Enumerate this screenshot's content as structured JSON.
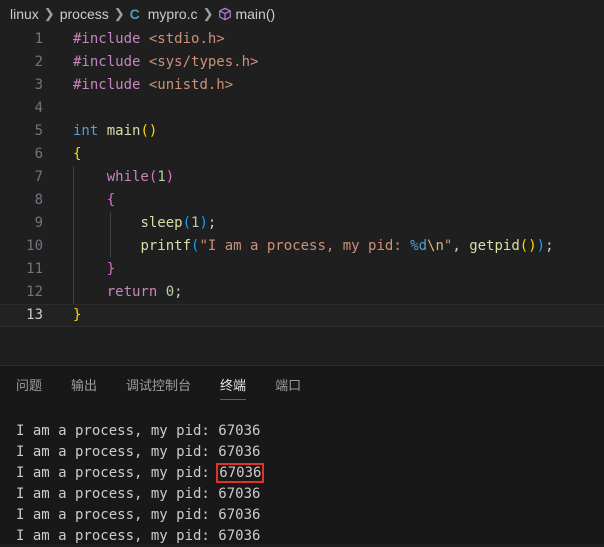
{
  "breadcrumb": {
    "items": [
      "linux",
      "process",
      "mypro.c",
      "main()"
    ],
    "file_icon": "C",
    "icons": [
      "c-file-icon",
      "cube-icon"
    ]
  },
  "editor": {
    "current_line": 13,
    "lines": [
      {
        "num": "1",
        "parts": [
          [
            "kw-inc",
            "#include"
          ],
          [
            "plain",
            " "
          ],
          [
            "str",
            "<stdio.h>"
          ]
        ]
      },
      {
        "num": "2",
        "parts": [
          [
            "kw-inc",
            "#include"
          ],
          [
            "plain",
            " "
          ],
          [
            "str",
            "<sys/types.h>"
          ]
        ]
      },
      {
        "num": "3",
        "parts": [
          [
            "kw-inc",
            "#include"
          ],
          [
            "plain",
            " "
          ],
          [
            "str",
            "<unistd.h>"
          ]
        ]
      },
      {
        "num": "4",
        "parts": []
      },
      {
        "num": "5",
        "parts": [
          [
            "kw-type",
            "int"
          ],
          [
            "plain",
            " "
          ],
          [
            "fn",
            "main"
          ],
          [
            "brace-y",
            "()"
          ]
        ]
      },
      {
        "num": "6",
        "parts": [
          [
            "brace-y",
            "{"
          ]
        ]
      },
      {
        "num": "7",
        "parts": [
          [
            "plain",
            "    "
          ],
          [
            "kw-ctrl",
            "while"
          ],
          [
            "brace-p",
            "("
          ],
          [
            "num",
            "1"
          ],
          [
            "brace-p",
            ")"
          ]
        ]
      },
      {
        "num": "8",
        "parts": [
          [
            "plain",
            "    "
          ],
          [
            "brace-p",
            "{"
          ]
        ]
      },
      {
        "num": "9",
        "parts": [
          [
            "plain",
            "        "
          ],
          [
            "fn",
            "sleep"
          ],
          [
            "brace-b",
            "("
          ],
          [
            "num",
            "1"
          ],
          [
            "brace-b",
            ")"
          ],
          [
            "plain",
            ";"
          ]
        ]
      },
      {
        "num": "10",
        "parts": [
          [
            "plain",
            "        "
          ],
          [
            "fn",
            "printf"
          ],
          [
            "brace-b",
            "("
          ],
          [
            "str",
            "\"I am a process, my pid: "
          ],
          [
            "kw-type",
            "%d"
          ],
          [
            "esc",
            "\\n"
          ],
          [
            "str",
            "\""
          ],
          [
            "plain",
            ", "
          ],
          [
            "fn",
            "getpid"
          ],
          [
            "brace-y",
            "()"
          ],
          [
            "brace-b",
            ")"
          ],
          [
            "plain",
            ";"
          ]
        ]
      },
      {
        "num": "11",
        "parts": [
          [
            "plain",
            "    "
          ],
          [
            "brace-p",
            "}"
          ]
        ]
      },
      {
        "num": "12",
        "parts": [
          [
            "plain",
            "    "
          ],
          [
            "kw-ctrl",
            "return"
          ],
          [
            "plain",
            " "
          ],
          [
            "num",
            "0"
          ],
          [
            "plain",
            ";"
          ]
        ]
      },
      {
        "num": "13",
        "parts": [
          [
            "brace-y",
            "}"
          ]
        ]
      }
    ]
  },
  "panel": {
    "tabs": [
      "问题",
      "输出",
      "调试控制台",
      "终端",
      "端口"
    ],
    "active_tab": "终端",
    "terminal_lines": [
      {
        "prefix": "I am a process, my pid: ",
        "pid": "67036",
        "highlight": false
      },
      {
        "prefix": "I am a process, my pid: ",
        "pid": "67036",
        "highlight": false
      },
      {
        "prefix": "I am a process, my pid: ",
        "pid": "67036",
        "highlight": true
      },
      {
        "prefix": "I am a process, my pid: ",
        "pid": "67036",
        "highlight": false
      },
      {
        "prefix": "I am a process, my pid: ",
        "pid": "67036",
        "highlight": false
      },
      {
        "prefix": "I am a process, my pid: ",
        "pid": "67036",
        "highlight": false
      }
    ],
    "highlight_color": "#e0312b"
  }
}
